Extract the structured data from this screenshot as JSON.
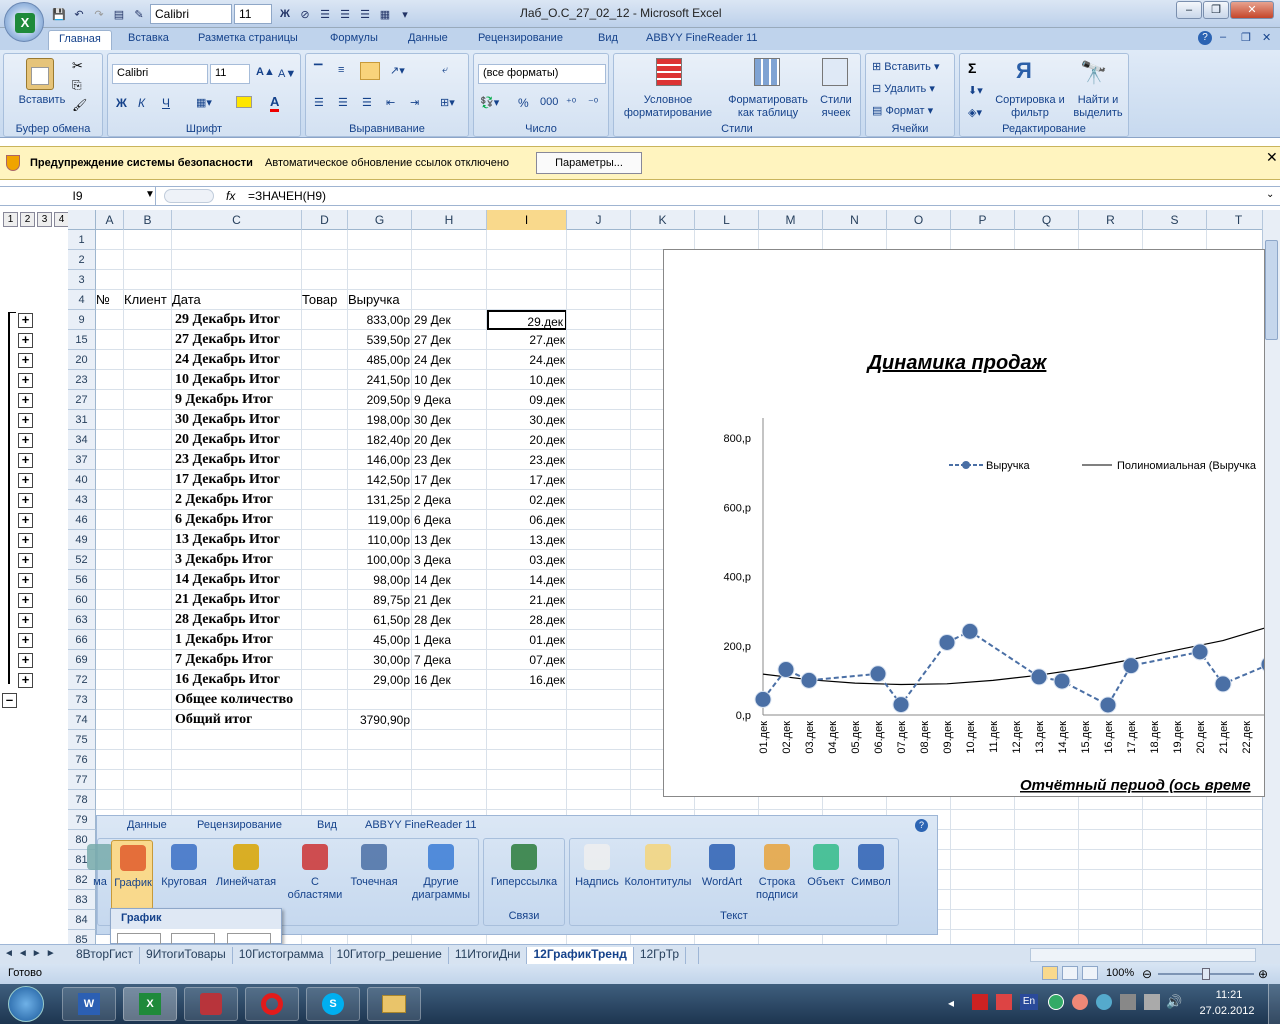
{
  "titlebar": {
    "font": "Calibri",
    "size": "11",
    "title": "Лаб_О.С_27_02_12 - Microsoft Excel",
    "min": "–",
    "max": "❐",
    "close": "✕"
  },
  "tabs": [
    "Главная",
    "Вставка",
    "Разметка страницы",
    "Формулы",
    "Данные",
    "Рецензирование",
    "Вид",
    "ABBYY FineReader 11"
  ],
  "ribbon": {
    "clipboard": {
      "paste": "Вставить",
      "label": "Буфер обмена"
    },
    "font": {
      "name": "Calibri",
      "size": "11",
      "label": "Шрифт",
      "bold": "Ж",
      "italic": "К",
      "underline": "Ч"
    },
    "align": {
      "label": "Выравнивание"
    },
    "number": {
      "format": "(все форматы)",
      "label": "Число",
      "pct": "%",
      "thousands": "000"
    },
    "styles": {
      "cond": "Условное форматирование",
      "table": "Форматировать как таблицу",
      "cell": "Стили ячеек",
      "label": "Стили"
    },
    "cells": {
      "insert": "Вставить",
      "delete": "Удалить",
      "format": "Формат",
      "label": "Ячейки"
    },
    "edit": {
      "sort": "Сортировка и фильтр",
      "find": "Найти и выделить",
      "label": "Редактирование",
      "sigma": "Σ"
    }
  },
  "security": {
    "title": "Предупреждение системы безопасности",
    "msg": "Автоматическое обновление ссылок отключено",
    "btn": "Параметры..."
  },
  "formula": {
    "cellref": "I9",
    "fx": "fx",
    "text": "=ЗНАЧЕН(H9)"
  },
  "levels": [
    "1",
    "2",
    "3",
    "4"
  ],
  "columns": [
    "A",
    "B",
    "C",
    "D",
    "G",
    "H",
    "I",
    "J",
    "K",
    "L",
    "M",
    "N",
    "O",
    "P",
    "Q",
    "R",
    "S",
    "T"
  ],
  "headerrow": {
    "num": "№",
    "client": "Клиент",
    "date": "Дата",
    "product": "Товар",
    "revenue": "Выручка"
  },
  "rows": [
    {
      "n": "1"
    },
    {
      "n": "2"
    },
    {
      "n": "3"
    },
    {
      "n": "4",
      "hdr": true
    },
    {
      "n": "9",
      "c": "29 Декабрь Итог",
      "g": "833,00р",
      "h": "29 Дек",
      "i": "29.дек",
      "b": true
    },
    {
      "n": "15",
      "c": "27 Декабрь Итог",
      "g": "539,50р",
      "h": "27 Дек",
      "i": "27.дек",
      "b": true
    },
    {
      "n": "20",
      "c": "24 Декабрь Итог",
      "g": "485,00р",
      "h": "24 Дек",
      "i": "24.дек",
      "b": true
    },
    {
      "n": "23",
      "c": "10 Декабрь Итог",
      "g": "241,50р",
      "h": "10 Дек",
      "i": "10.дек",
      "b": true
    },
    {
      "n": "27",
      "c": "9 Декабрь Итог",
      "g": "209,50р",
      "h": "9 Дека",
      "i": "09.дек",
      "b": true
    },
    {
      "n": "31",
      "c": "30 Декабрь Итог",
      "g": "198,00р",
      "h": "30 Дек",
      "i": "30.дек",
      "b": true
    },
    {
      "n": "34",
      "c": "20 Декабрь Итог",
      "g": "182,40р",
      "h": "20 Дек",
      "i": "20.дек",
      "b": true
    },
    {
      "n": "37",
      "c": "23 Декабрь Итог",
      "g": "146,00р",
      "h": "23 Дек",
      "i": "23.дек",
      "b": true
    },
    {
      "n": "40",
      "c": "17 Декабрь Итог",
      "g": "142,50р",
      "h": "17 Дек",
      "i": "17.дек",
      "b": true
    },
    {
      "n": "43",
      "c": "2 Декабрь Итог",
      "g": "131,25р",
      "h": "2 Дека",
      "i": "02.дек",
      "b": true
    },
    {
      "n": "46",
      "c": "6 Декабрь Итог",
      "g": "119,00р",
      "h": "6 Дека",
      "i": "06.дек",
      "b": true
    },
    {
      "n": "49",
      "c": "13 Декабрь Итог",
      "g": "110,00р",
      "h": "13 Дек",
      "i": "13.дек",
      "b": true
    },
    {
      "n": "52",
      "c": "3 Декабрь Итог",
      "g": "100,00р",
      "h": "3 Дека",
      "i": "03.дек",
      "b": true
    },
    {
      "n": "56",
      "c": "14 Декабрь Итог",
      "g": "98,00р",
      "h": "14 Дек",
      "i": "14.дек",
      "b": true
    },
    {
      "n": "60",
      "c": "21 Декабрь Итог",
      "g": "89,75р",
      "h": "21 Дек",
      "i": "21.дек",
      "b": true
    },
    {
      "n": "63",
      "c": "28 Декабрь Итог",
      "g": "61,50р",
      "h": "28 Дек",
      "i": "28.дек",
      "b": true
    },
    {
      "n": "66",
      "c": "1 Декабрь Итог",
      "g": "45,00р",
      "h": "1 Дека",
      "i": "01.дек",
      "b": true
    },
    {
      "n": "69",
      "c": "7 Декабрь Итог",
      "g": "30,00р",
      "h": "7 Дека",
      "i": "07.дек",
      "b": true
    },
    {
      "n": "72",
      "c": "16 Декабрь Итог",
      "g": "29,00р",
      "h": "16 Дек",
      "i": "16.дек",
      "b": true
    },
    {
      "n": "73",
      "c": "Общее количество"
    },
    {
      "n": "74",
      "c": "Общий итог",
      "g": "3790,90р"
    },
    {
      "n": "75"
    },
    {
      "n": "76"
    },
    {
      "n": "77"
    },
    {
      "n": "78"
    },
    {
      "n": "79"
    },
    {
      "n": "80"
    },
    {
      "n": "81"
    },
    {
      "n": "82"
    },
    {
      "n": "83"
    },
    {
      "n": "84"
    },
    {
      "n": "85"
    }
  ],
  "chart_data": {
    "type": "line",
    "title": "Динамика продаж",
    "xlabel": "Отчётный период (ось време",
    "ylabel": "",
    "ylim": [
      0,
      800
    ],
    "yticks": [
      "0,р",
      "200,р",
      "400,р",
      "600,р",
      "800,р"
    ],
    "categories": [
      "01.дек",
      "02.дек",
      "03.дек",
      "04.дек",
      "05.дек",
      "06.дек",
      "07.дек",
      "08.дек",
      "09.дек",
      "10.дек",
      "11.дек",
      "12.дек",
      "13.дек",
      "14.дек",
      "15.дек",
      "16.дек",
      "17.дек",
      "18.дек",
      "19.дек",
      "20.дек",
      "21.дек",
      "22.дек"
    ],
    "series": [
      {
        "name": "Выручка",
        "points": [
          [
            0,
            45
          ],
          [
            1,
            131.25
          ],
          [
            2,
            100
          ],
          [
            5,
            119
          ],
          [
            6,
            30
          ],
          [
            8,
            209.5
          ],
          [
            9,
            241.5
          ],
          [
            12,
            110
          ],
          [
            13,
            98
          ],
          [
            15,
            29
          ],
          [
            16,
            142.5
          ],
          [
            19,
            182.4
          ],
          [
            20,
            89.75
          ],
          [
            22,
            146
          ]
        ],
        "color": "#4a6fa5"
      },
      {
        "name": "Полиномиальная (Выручка)",
        "points": [
          [
            0,
            118
          ],
          [
            2,
            102
          ],
          [
            4,
            92
          ],
          [
            6,
            88
          ],
          [
            8,
            90
          ],
          [
            10,
            100
          ],
          [
            12,
            115
          ],
          [
            14,
            135
          ],
          [
            16,
            160
          ],
          [
            18,
            188
          ],
          [
            20,
            215
          ],
          [
            22,
            255
          ]
        ],
        "color": "#000000"
      }
    ],
    "legend": [
      "Выручка",
      "Полиномиальная (Выручка"
    ]
  },
  "insertpanel": {
    "tabs": [
      "Данные",
      "Рецензирование",
      "Вид",
      "ABBYY FineReader 11"
    ],
    "items": [
      "ма",
      "График",
      "Круговая",
      "Линейчатая",
      "С областями",
      "Точечная",
      "Другие диаграммы",
      "Гиперссылка",
      "Надпись",
      "Колонтитулы",
      "WordArt",
      "Строка подписи",
      "Объект",
      "Символ"
    ],
    "groups": [
      "Связи",
      "Текст"
    ],
    "popup": "График"
  },
  "sheets": [
    "8ВторГист",
    "9ИтогиТовары",
    "10Гистограмма",
    "10Гитогр_решение",
    "11ИтогиДни",
    "12ГрафикТренд",
    "12ГрТр"
  ],
  "status": {
    "ready": "Готово",
    "zoom": "100%"
  },
  "clock": {
    "time": "11:21",
    "date": "27.02.2012",
    "lang": "En"
  }
}
